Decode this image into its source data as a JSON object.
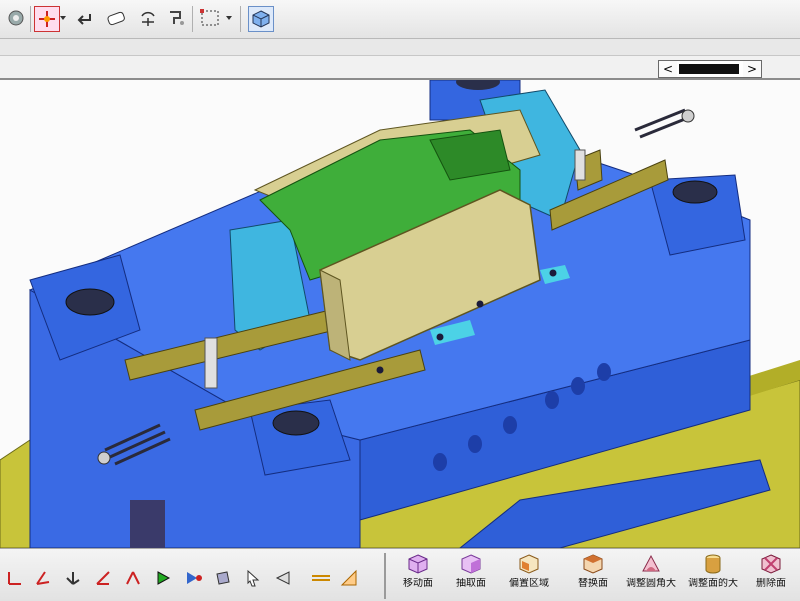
{
  "top_toolbar": {
    "icons": [
      "gear-icon",
      "pick-point-icon",
      "undo-icon",
      "eraser-icon",
      "rotate-icon",
      "paint-icon",
      "select-box-icon",
      "view-cube-icon"
    ]
  },
  "bottom_toolbar": {
    "tools": [
      "axis-1-icon",
      "axis-2-icon",
      "axis-3-icon",
      "axis-4-icon",
      "axis-5-icon",
      "play-icon",
      "forward-icon",
      "mirror-icon",
      "cursor-icon",
      "dimension-icon",
      "line-icon",
      "ruler-icon"
    ],
    "commands": [
      {
        "label": "移动面",
        "icon": "move-face-icon",
        "color": "#b070d0"
      },
      {
        "label": "抽取面",
        "icon": "extract-face-icon",
        "color": "#c070d8"
      },
      {
        "label": "偏置区域",
        "icon": "offset-region-icon",
        "color": "#e08030"
      },
      {
        "label": "替换面",
        "icon": "replace-face-icon",
        "color": "#d07030"
      },
      {
        "label": "调整圆角大小",
        "icon": "resize-blend-icon",
        "color": "#d06880"
      },
      {
        "label": "调整面的大小",
        "icon": "resize-face-icon",
        "color": "#d8a040"
      },
      {
        "label": "删除面",
        "icon": "delete-face-icon",
        "color": "#c04070"
      }
    ]
  },
  "colors": {
    "mold_blue": "#2f5fd8",
    "base_yellow": "#c8c43a",
    "core_green": "#3fae3a",
    "slider_cyan": "#3fb6e0",
    "insert_tan": "#d8cf92",
    "rail_olive": "#a89b3a"
  }
}
